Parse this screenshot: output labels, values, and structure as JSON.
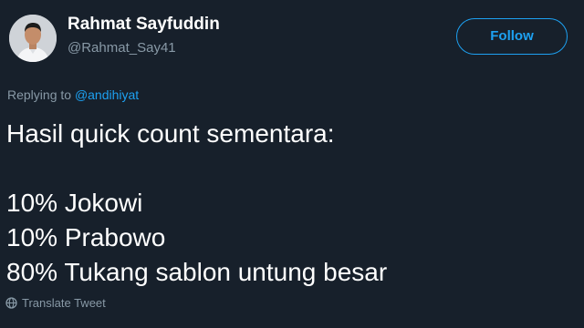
{
  "author": {
    "display_name": "Rahmat Sayfuddin",
    "handle": "@Rahmat_Say41"
  },
  "follow_button": {
    "label": "Follow"
  },
  "reply": {
    "prefix": "Replying to ",
    "mention": "@andihiyat"
  },
  "tweet": {
    "line1": "Hasil quick count sementara:",
    "line2": "10% Jokowi",
    "line3": "10% Prabowo",
    "line4": "80% Tukang sablon untung besar"
  },
  "translate": {
    "label": "Translate Tweet",
    "icon": "globe-icon"
  },
  "colors": {
    "background": "#17202b",
    "accent": "#1da1f2",
    "muted": "#8899a6",
    "text": "#ffffff"
  }
}
